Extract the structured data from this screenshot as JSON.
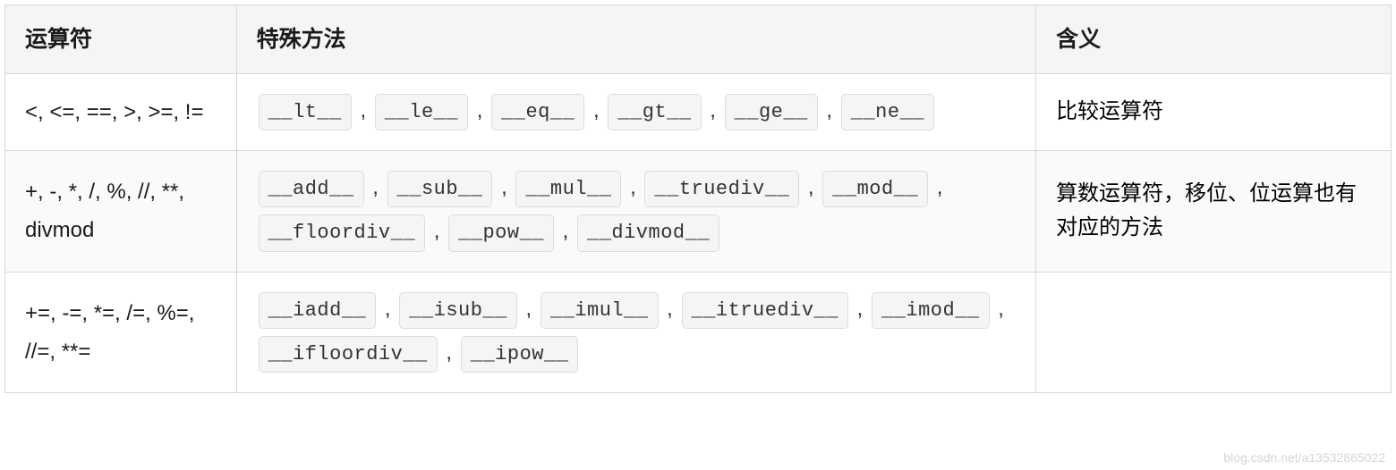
{
  "headers": {
    "operator": "运算符",
    "method": "特殊方法",
    "meaning": "含义"
  },
  "rows": [
    {
      "operator": "<, <=, ==, >, >=, !=",
      "methods": [
        "__lt__",
        "__le__",
        "__eq__",
        "__gt__",
        "__ge__",
        "__ne__"
      ],
      "meaning": "比较运算符"
    },
    {
      "operator": "+, -, *, /, %, //, **, divmod",
      "methods": [
        "__add__",
        "__sub__",
        "__mul__",
        "__truediv__",
        "__mod__",
        "__floordiv__",
        "__pow__",
        "__divmod__"
      ],
      "meaning": "算数运算符，移位、位运算也有对应的方法"
    },
    {
      "operator": "+=, -=, *=, /=, %=, //=, **=",
      "methods": [
        "__iadd__",
        "__isub__",
        "__imul__",
        "__itruediv__",
        "__imod__",
        "__ifloordiv__",
        "__ipow__"
      ],
      "meaning": ""
    }
  ],
  "separator": " , ",
  "watermark": "blog.csdn.net/a13532865022"
}
